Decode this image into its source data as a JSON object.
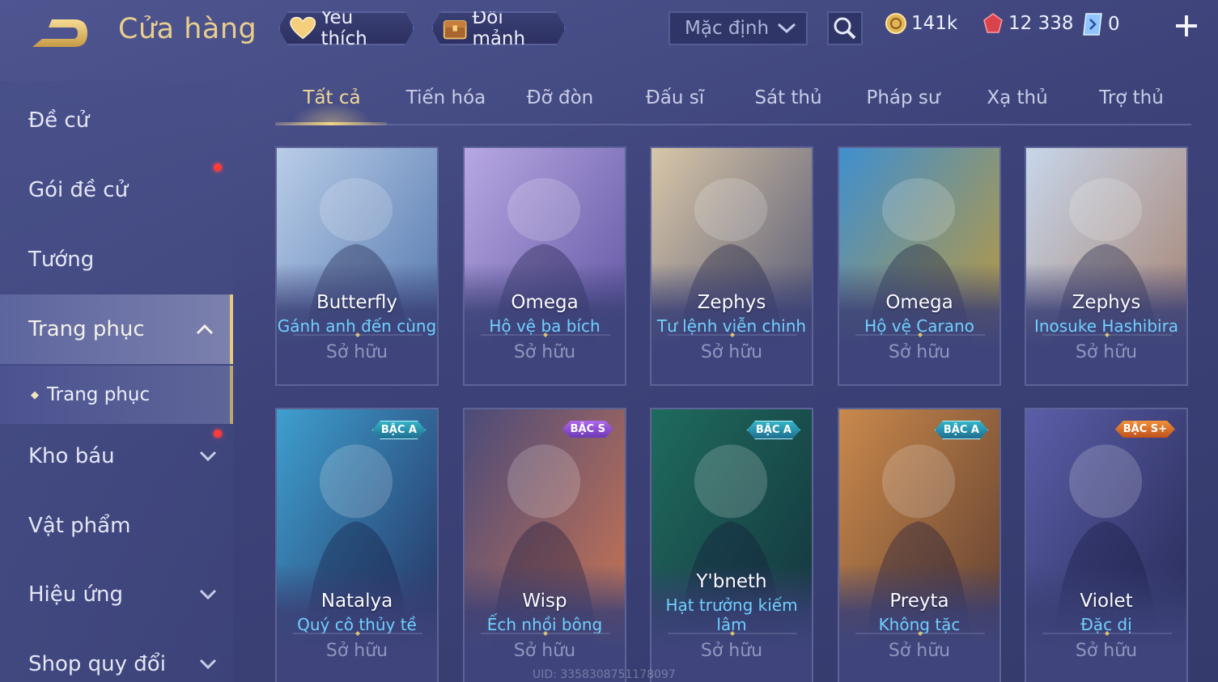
{
  "header": {
    "title": "Cửa hàng",
    "favorite_label": "Yêu thích",
    "fragment_label": "Đổi mảnh",
    "sort_label": "Mặc định",
    "gold": "141k",
    "diamonds": "12 338",
    "vouchers": "0"
  },
  "sidebar": {
    "items": [
      {
        "label": "Đề cử"
      },
      {
        "label": "Gói đề cử"
      },
      {
        "label": "Tướng"
      },
      {
        "label": "Trang phục"
      },
      {
        "label": "Trang phục"
      },
      {
        "label": "Kho báu"
      },
      {
        "label": "Vật phẩm"
      },
      {
        "label": "Hiệu ứng"
      },
      {
        "label": "Shop quy đổi"
      }
    ]
  },
  "tabs": [
    "Tất cả",
    "Tiến hóa",
    "Đỡ đòn",
    "Đấu sĩ",
    "Sát thủ",
    "Pháp sư",
    "Xạ thủ",
    "Trợ thủ"
  ],
  "cards": [
    {
      "hero": "Butterfly",
      "skin": "Gánh anh đến cùng",
      "status": "Sở hữu",
      "colors": [
        "#b9cde8",
        "#4a6fa8"
      ]
    },
    {
      "hero": "Omega",
      "skin": "Hộ vệ ba bích",
      "status": "Sở hữu",
      "colors": [
        "#b7a7e3",
        "#5a4d9c"
      ]
    },
    {
      "hero": "Zephys",
      "skin": "Tư lệnh viễn chinh",
      "status": "Sở hữu",
      "colors": [
        "#d8c6a8",
        "#4b4f70"
      ]
    },
    {
      "hero": "Omega",
      "skin": "Hộ vệ Carano",
      "status": "Sở hữu",
      "colors": [
        "#3f8fd0",
        "#c99a2e"
      ]
    },
    {
      "hero": "Zephys",
      "skin": "Inosuke Hashibira",
      "status": "Sở hữu",
      "colors": [
        "#c7d6ea",
        "#a37b67"
      ]
    },
    {
      "hero": "Natalya",
      "skin": "Quý cô thủy tề",
      "status": "Sở hữu",
      "badge": "BẬC A",
      "colors": [
        "#3e9fcf",
        "#232a5a"
      ]
    },
    {
      "hero": "Wisp",
      "skin": "Ếch nhồi bông",
      "status": "Sở hữu",
      "badge": "BẬC S",
      "colors": [
        "#4a4a7a",
        "#d7784e"
      ]
    },
    {
      "hero": "Y'bneth",
      "skin": "Hạt trưởng kiếm lâm",
      "status": "Sở hữu",
      "badge": "BẬC A",
      "colors": [
        "#1f6b5e",
        "#13303a"
      ]
    },
    {
      "hero": "Preyta",
      "skin": "Không tặc",
      "status": "Sở hữu",
      "badge": "BẬC A",
      "colors": [
        "#c9894c",
        "#5a3a2e"
      ]
    },
    {
      "hero": "Violet",
      "skin": "Đặc dị",
      "status": "Sở hữu",
      "badge": "BẬC S+",
      "colors": [
        "#5b5ea8",
        "#232650"
      ]
    }
  ],
  "footer": {
    "uid": "UID: 3358308751178097"
  }
}
